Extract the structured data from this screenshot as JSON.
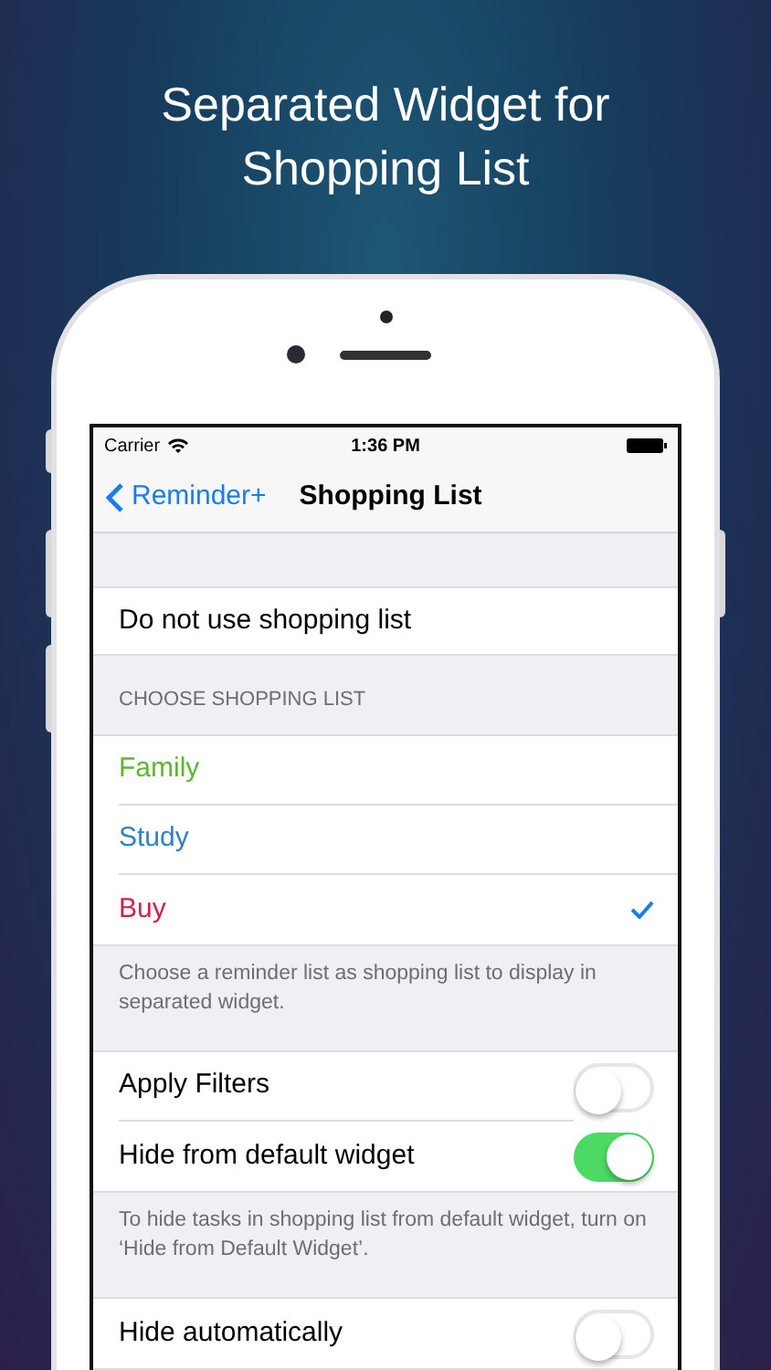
{
  "headline": [
    "Separated Widget for",
    "Shopping List"
  ],
  "status_bar": {
    "carrier": "Carrier",
    "time": "1:36 PM"
  },
  "nav": {
    "back": "Reminder+",
    "title": "Shopping List"
  },
  "none_option": {
    "label": "Do not use shopping list"
  },
  "section_header": "CHOOSE SHOPPING LIST",
  "lists": [
    {
      "label": "Family",
      "color": "#5cb82e",
      "selected": false
    },
    {
      "label": "Study",
      "color": "#2f80c4",
      "selected": false
    },
    {
      "label": "Buy",
      "color": "#cf1f4e",
      "selected": true
    }
  ],
  "lists_footer": "Choose a reminder list as shopping list to display in separated widget.",
  "toggles": [
    {
      "label": "Apply Filters",
      "on": false
    },
    {
      "label": "Hide from default widget",
      "on": true
    }
  ],
  "toggles_footer": "To hide tasks in shopping list from default widget, turn on ‘Hide from Default Widget’.",
  "auto_toggle": {
    "label": "Hide automatically",
    "on": false
  }
}
